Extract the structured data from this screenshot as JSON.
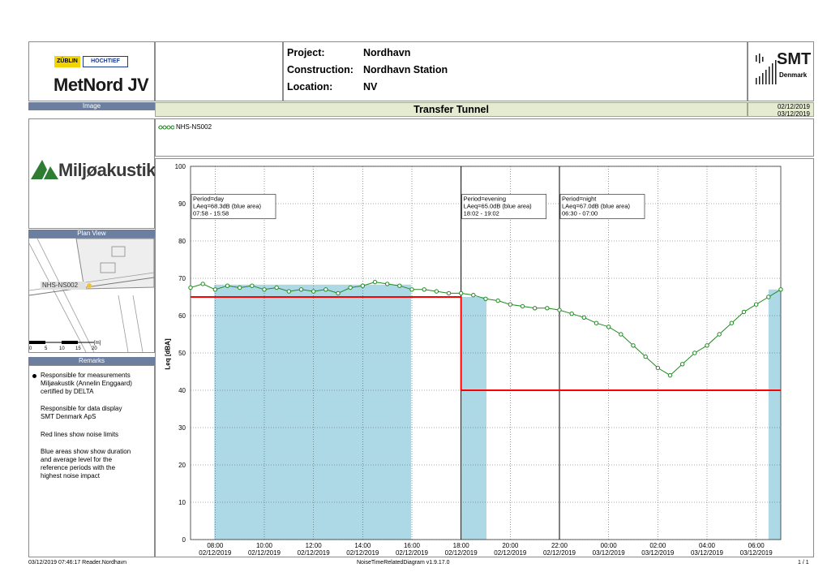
{
  "header": {
    "logo_zublin": "ZÜBLIN",
    "logo_hochtief": "HOCHTIEF",
    "logo_metnord": "MetNord JV",
    "project_label": "Project:",
    "project_value": "Nordhavn",
    "construction_label": "Construction:",
    "construction_value": "Nordhavn Station",
    "location_label": "Location:",
    "location_value": "NV",
    "smt_logo": "SMT",
    "smt_sub": "Denmark"
  },
  "image_band": "Image",
  "title": "Transfer Tunnel",
  "date_from": "02/12/2019",
  "date_to": "03/12/2019",
  "legend": {
    "series": "NHS-NS002"
  },
  "left": {
    "miljo_logo": "Miljøakustik",
    "plan_view_label": "Plan View",
    "plan_marker": "NHS-NS002",
    "scale_unit": "[m]",
    "scale_ticks": [
      "0",
      "5",
      "10",
      "15",
      "20"
    ],
    "remarks_label": "Remarks",
    "remarks": [
      "Responsible for measurements",
      "Miljøakustik (Annelin Enggaard)",
      "certified by DELTA",
      "Responsible for data display",
      "SMT Denmark ApS",
      "Red lines show noise limits",
      "Blue areas show show duration",
      "and average level for the",
      "reference periods with the",
      "highest noise impact"
    ]
  },
  "colors": {
    "accent_blue": "#6d7fa1",
    "area_blue": "#add8e6",
    "series_green": "#1f8a1f",
    "limit_red": "#ff0000",
    "title_band": "#e4ebd1"
  },
  "footer": {
    "left": "03/12/2019 07:46:17  Reader.Nordhavn",
    "center": "NoiseTimeRelatedDiagram v1.9.17.0",
    "right": "1 / 1"
  },
  "chart_data": {
    "type": "line",
    "ylabel": "Leq [dBA]",
    "ylim": [
      0,
      100
    ],
    "yticks": [
      0,
      10,
      20,
      30,
      40,
      50,
      60,
      70,
      80,
      90,
      100
    ],
    "xlim": [
      "2019-12-02 07:00",
      "2019-12-03 07:00"
    ],
    "xticks": [
      {
        "time": "08:00",
        "date": "02/12/2019"
      },
      {
        "time": "10:00",
        "date": "02/12/2019"
      },
      {
        "time": "12:00",
        "date": "02/12/2019"
      },
      {
        "time": "14:00",
        "date": "02/12/2019"
      },
      {
        "time": "16:00",
        "date": "02/12/2019"
      },
      {
        "time": "18:00",
        "date": "02/12/2019"
      },
      {
        "time": "20:00",
        "date": "02/12/2019"
      },
      {
        "time": "22:00",
        "date": "02/12/2019"
      },
      {
        "time": "00:00",
        "date": "03/12/2019"
      },
      {
        "time": "02:00",
        "date": "03/12/2019"
      },
      {
        "time": "04:00",
        "date": "03/12/2019"
      },
      {
        "time": "06:00",
        "date": "03/12/2019"
      }
    ],
    "grid": true,
    "period_dividers": [
      "2019-12-02 18:00",
      "2019-12-02 22:00"
    ],
    "periods": [
      {
        "lines": [
          "Period=day",
          "LAeq=68.3dB (blue area)",
          "07:58 - 15:58"
        ]
      },
      {
        "lines": [
          "Period=evening",
          "LAeq=65.0dB (blue area)",
          "18:02 - 19:02"
        ]
      },
      {
        "lines": [
          "Period=night",
          "LAeq=67.0dB (blue area)",
          "06:30 - 07:00"
        ]
      }
    ],
    "limits": [
      {
        "from": "2019-12-02 07:00",
        "to": "2019-12-02 18:00",
        "value": 65
      },
      {
        "from": "2019-12-02 18:00",
        "to": "2019-12-03 07:00",
        "value": 40
      }
    ],
    "blue_areas": [
      {
        "from": "2019-12-02 07:58",
        "to": "2019-12-02 15:58",
        "value": 68.3
      },
      {
        "from": "2019-12-02 18:02",
        "to": "2019-12-02 19:02",
        "value": 65.0
      },
      {
        "from": "2019-12-03 06:30",
        "to": "2019-12-03 07:00",
        "value": 67.0
      }
    ],
    "series": [
      {
        "name": "NHS-NS002",
        "points": [
          [
            "2019-12-02 07:00",
            67.5
          ],
          [
            "2019-12-02 07:30",
            68.5
          ],
          [
            "2019-12-02 08:00",
            67.0
          ],
          [
            "2019-12-02 08:30",
            68.0
          ],
          [
            "2019-12-02 09:00",
            67.5
          ],
          [
            "2019-12-02 09:30",
            68.0
          ],
          [
            "2019-12-02 10:00",
            67.0
          ],
          [
            "2019-12-02 10:30",
            67.5
          ],
          [
            "2019-12-02 11:00",
            66.5
          ],
          [
            "2019-12-02 11:30",
            67.0
          ],
          [
            "2019-12-02 12:00",
            66.5
          ],
          [
            "2019-12-02 12:30",
            67.0
          ],
          [
            "2019-12-02 13:00",
            66.0
          ],
          [
            "2019-12-02 13:30",
            67.5
          ],
          [
            "2019-12-02 14:00",
            68.0
          ],
          [
            "2019-12-02 14:30",
            69.0
          ],
          [
            "2019-12-02 15:00",
            68.5
          ],
          [
            "2019-12-02 15:30",
            68.0
          ],
          [
            "2019-12-02 16:00",
            67.0
          ],
          [
            "2019-12-02 16:30",
            67.0
          ],
          [
            "2019-12-02 17:00",
            66.5
          ],
          [
            "2019-12-02 17:30",
            66.0
          ],
          [
            "2019-12-02 18:00",
            66.0
          ],
          [
            "2019-12-02 18:30",
            65.5
          ],
          [
            "2019-12-02 19:00",
            64.5
          ],
          [
            "2019-12-02 19:30",
            64.0
          ],
          [
            "2019-12-02 20:00",
            63.0
          ],
          [
            "2019-12-02 20:30",
            62.5
          ],
          [
            "2019-12-02 21:00",
            62.0
          ],
          [
            "2019-12-02 21:30",
            62.0
          ],
          [
            "2019-12-02 22:00",
            61.5
          ],
          [
            "2019-12-02 22:30",
            60.5
          ],
          [
            "2019-12-02 23:00",
            59.5
          ],
          [
            "2019-12-02 23:30",
            58.0
          ],
          [
            "2019-12-03 00:00",
            57.0
          ],
          [
            "2019-12-03 00:30",
            55.0
          ],
          [
            "2019-12-03 01:00",
            52.0
          ],
          [
            "2019-12-03 01:30",
            49.0
          ],
          [
            "2019-12-03 02:00",
            46.0
          ],
          [
            "2019-12-03 02:30",
            44.0
          ],
          [
            "2019-12-03 03:00",
            47.0
          ],
          [
            "2019-12-03 03:30",
            50.0
          ],
          [
            "2019-12-03 04:00",
            52.0
          ],
          [
            "2019-12-03 04:30",
            55.0
          ],
          [
            "2019-12-03 05:00",
            58.0
          ],
          [
            "2019-12-03 05:30",
            61.0
          ],
          [
            "2019-12-03 06:00",
            63.0
          ],
          [
            "2019-12-03 06:30",
            65.0
          ],
          [
            "2019-12-03 07:00",
            67.0
          ]
        ]
      }
    ]
  }
}
